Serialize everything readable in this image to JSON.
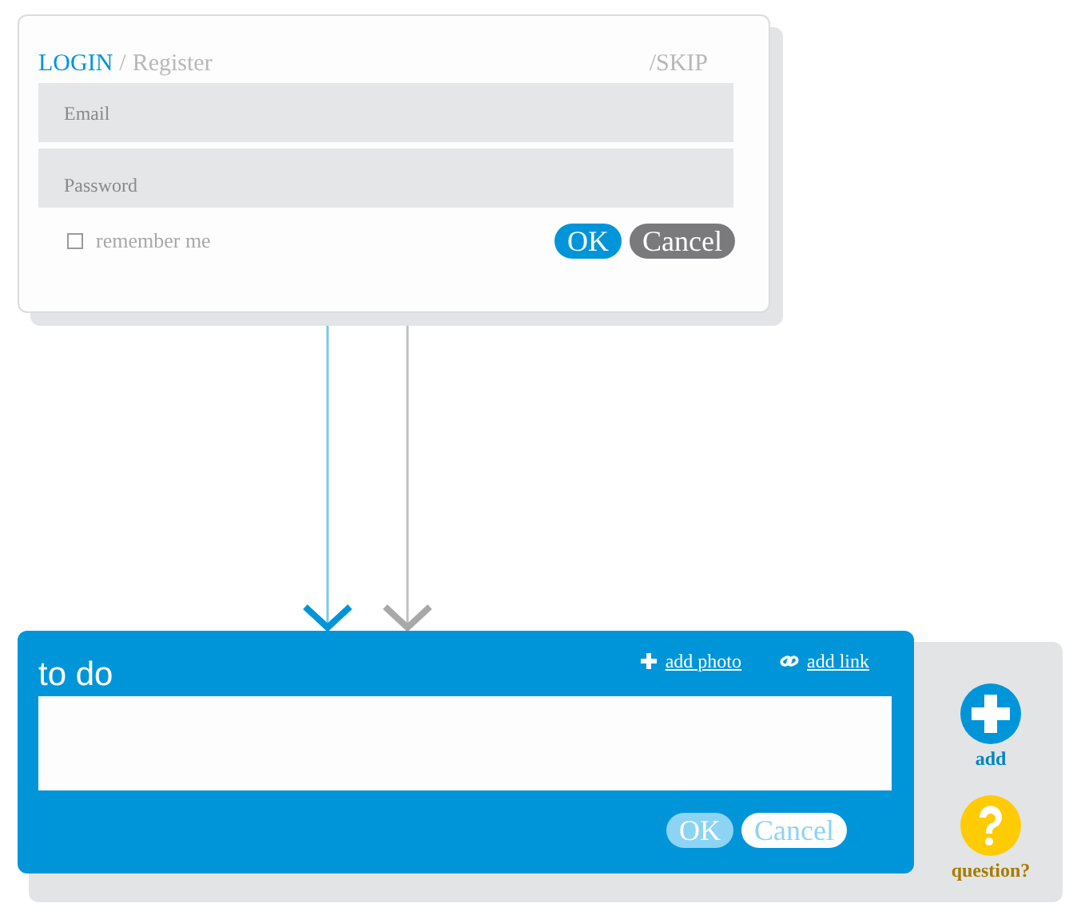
{
  "login": {
    "tabs": [
      {
        "label": "LOGIN",
        "selected": true
      },
      {
        "label": "Register",
        "selected": false
      }
    ],
    "separator": "/",
    "skip": "/SKIP",
    "fields": [
      {
        "placeholder": "Email"
      },
      {
        "placeholder": "Password"
      }
    ],
    "remember": {
      "label": "remember me",
      "checked": false
    },
    "buttons": [
      "OK",
      "Cancel"
    ]
  },
  "todo": {
    "title": "to do",
    "actions": [
      {
        "label": "add photo",
        "kind": "plus"
      },
      {
        "label": "add link",
        "kind": "link"
      }
    ],
    "buttons": [
      "OK",
      "Cancel"
    ]
  },
  "side_actions": [
    {
      "label": "add",
      "kind": "add",
      "color": "#0095d9"
    },
    {
      "label": "question?",
      "kind": "question",
      "color": "#ffcb05"
    }
  ]
}
